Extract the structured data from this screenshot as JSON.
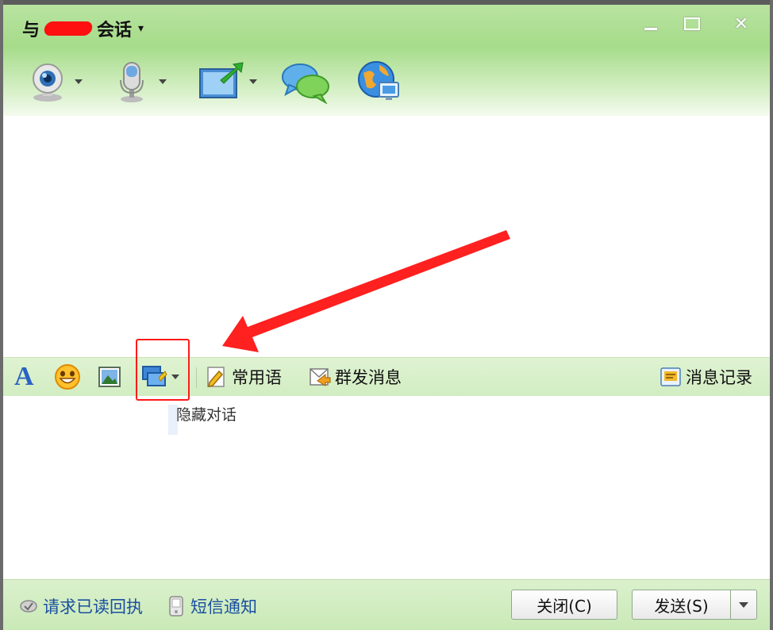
{
  "window": {
    "title_prefix": "与",
    "title_suffix": "会话",
    "title_caret": "▾",
    "minimize_glyph": "",
    "maximize_glyph": "",
    "close_glyph": "✕"
  },
  "toolbar": {
    "items": [
      {
        "icon": "webcam-icon",
        "has_dropdown": true
      },
      {
        "icon": "microphone-icon",
        "has_dropdown": true
      },
      {
        "icon": "send-file-icon",
        "has_dropdown": true
      },
      {
        "icon": "chat-bubbles-icon",
        "has_dropdown": false
      },
      {
        "icon": "globe-app-icon",
        "has_dropdown": false
      }
    ]
  },
  "format_bar": {
    "font_glyph": "A",
    "phrases_label": "常用语",
    "group_send_label": "群发消息",
    "history_label": "消息记录",
    "hide_conversation_tooltip": "隐藏对话"
  },
  "bottom_bar": {
    "read_receipt_label": "请求已读回执",
    "sms_notify_label": "短信通知",
    "close_button_label": "关闭(C)",
    "send_button_label": "发送(S)"
  },
  "colors": {
    "header_green": "#a6dc8a",
    "bar_green": "#d2edc2",
    "highlight_red": "#ff1a1a",
    "link_blue": "#1a4fa0"
  }
}
